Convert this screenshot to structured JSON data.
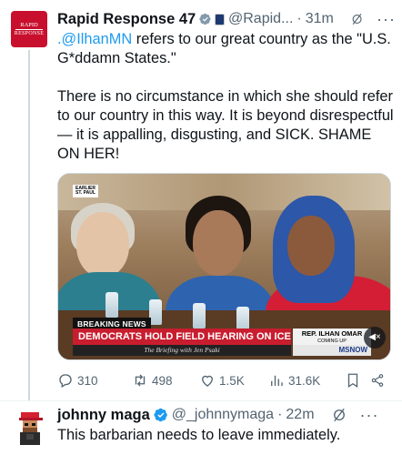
{
  "tweet": {
    "author": {
      "name": "Rapid Response 47",
      "handle": "@Rapid...",
      "avatar_text_top": "RAPID",
      "avatar_text_bottom": "RESPONSE"
    },
    "time": "31m",
    "text_mention": ".@IlhanMN",
    "text_rest": " refers to our great country as the \"U.S. G*ddamn States.\"\n\nThere is no circumstance in which she should refer to our country in this way. It is beyond disrespectful — it is appalling, disgusting, and SICK. SHAME ON HER!",
    "video": {
      "location_bug": "EARLIER\nST. PAUL",
      "breaking_label": "BREAKING NEWS",
      "headline": "DEMOCRATS HOLD FIELD HEARING ON ICE ABUSES",
      "show": "The Briefing with Jen Psaki",
      "nameplate_name": "REP. ILHAN OMAR",
      "nameplate_sub": "COMING UP",
      "network": "MSNOW"
    },
    "stats": {
      "replies": "310",
      "reposts": "498",
      "likes": "1.5K",
      "views": "31.6K"
    }
  },
  "reply": {
    "author": {
      "name": "johnny maga",
      "handle": "@_johnnymaga"
    },
    "time": "22m",
    "text": "This barbarian needs to leave immediately."
  },
  "colors": {
    "accent": "#1d9bf0",
    "muted": "#536471",
    "headline_red": "#c81d2f"
  },
  "icons": [
    "verified-icon",
    "grok-icon",
    "reply-icon",
    "repost-icon",
    "like-icon",
    "views-icon",
    "bookmark-icon",
    "share-icon",
    "mute-icon"
  ]
}
